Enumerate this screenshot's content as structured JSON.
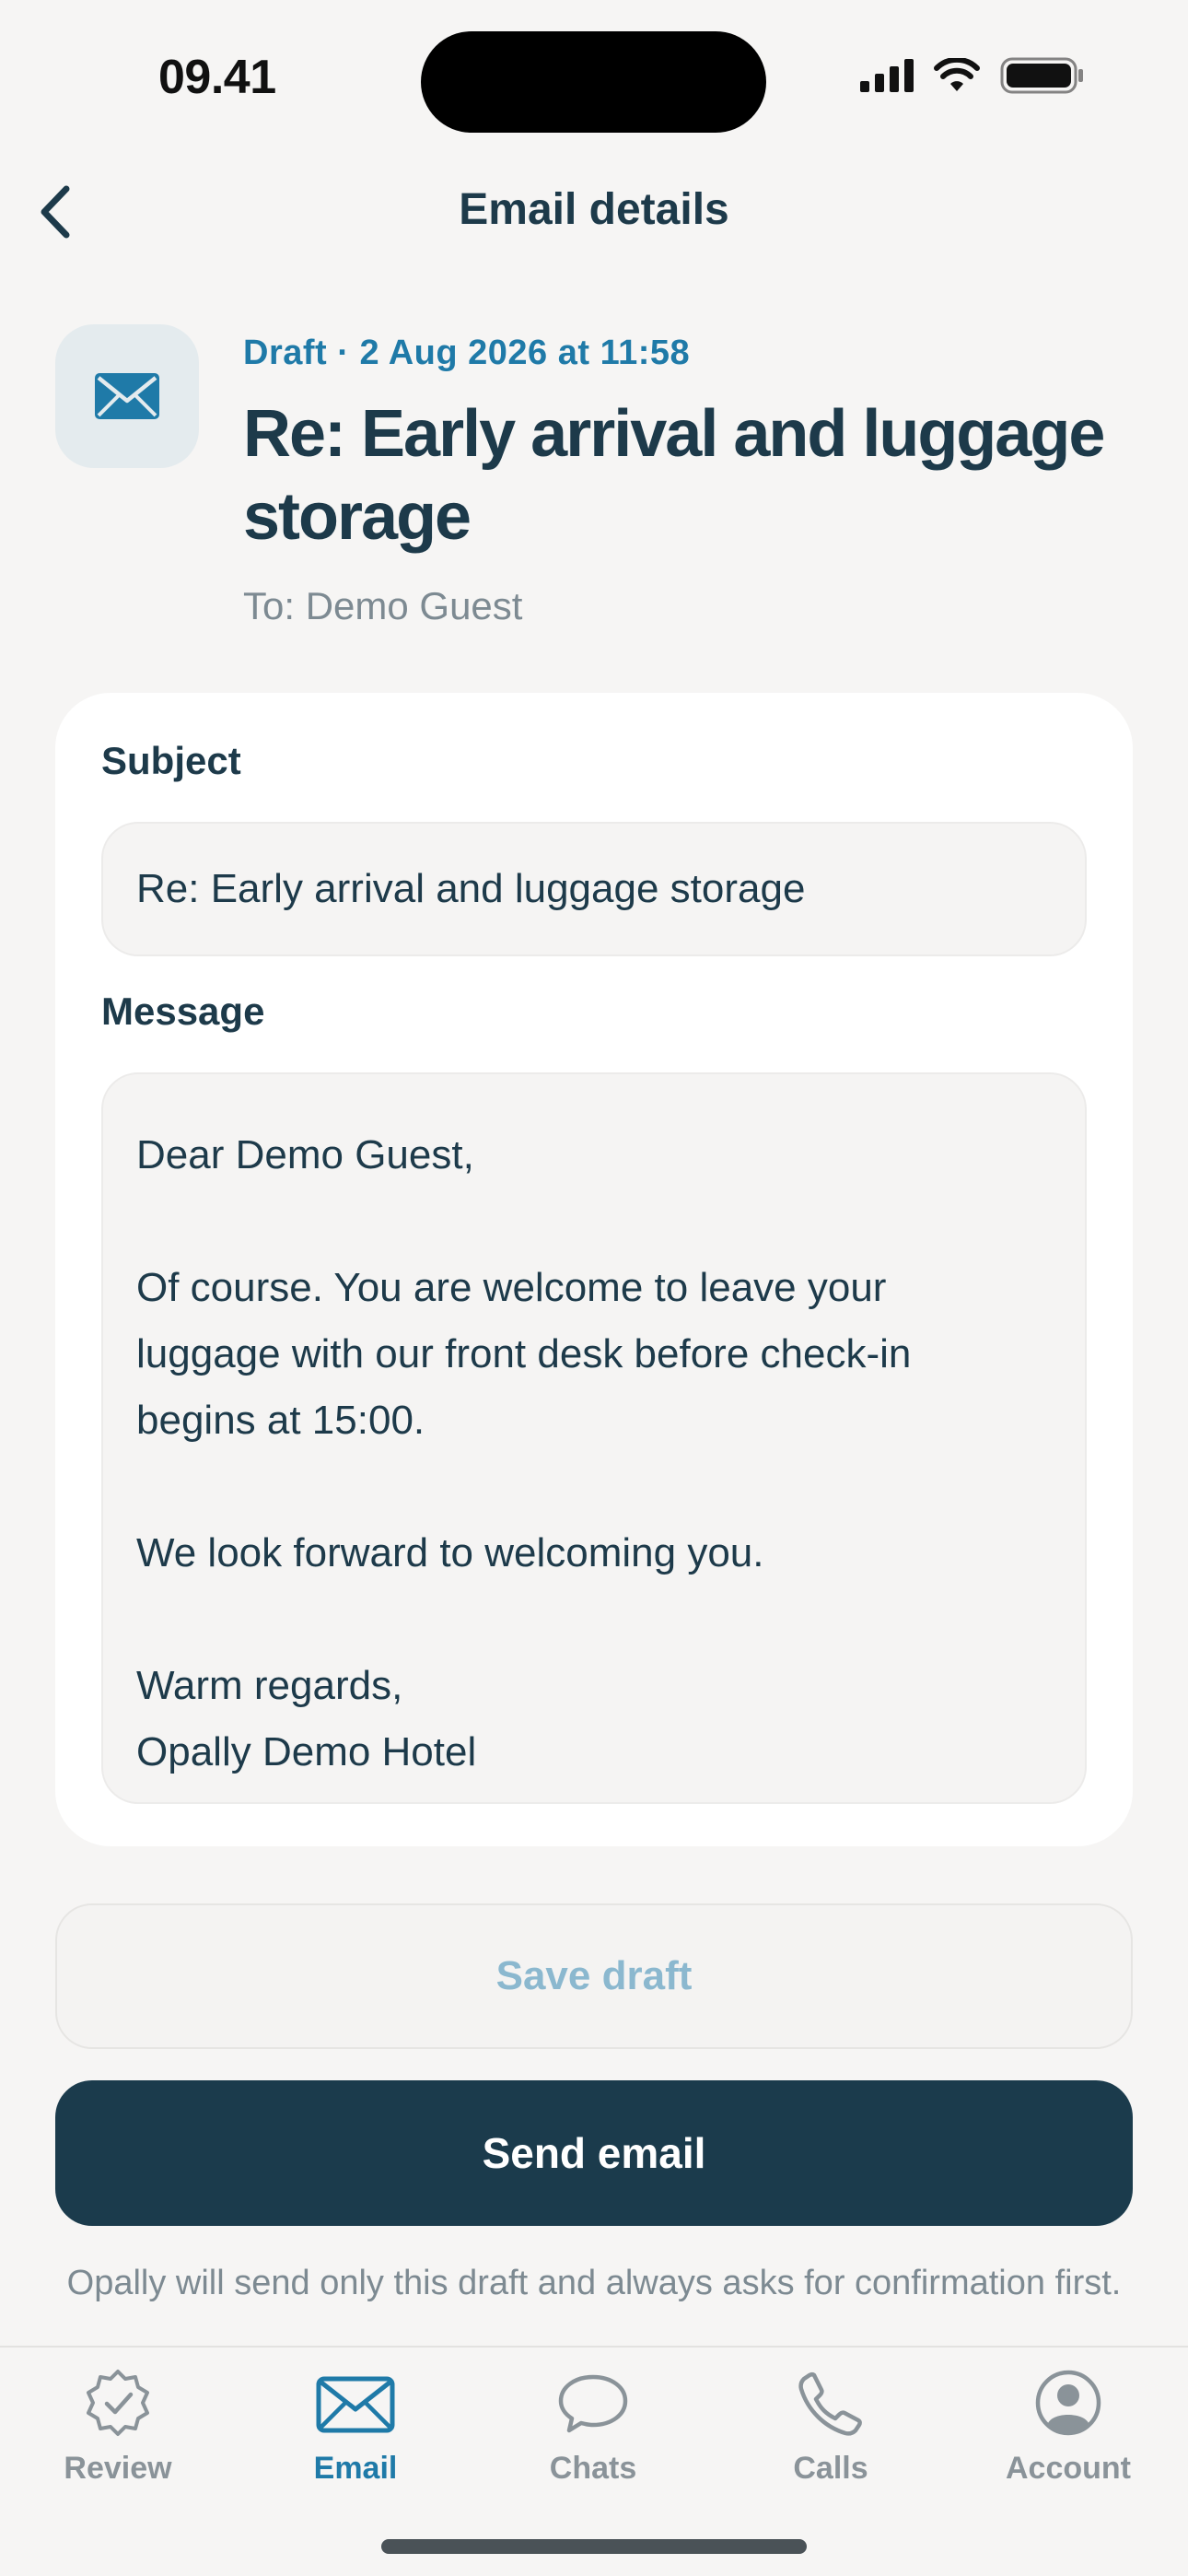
{
  "status_bar": {
    "time": "09.41"
  },
  "header": {
    "title": "Email details"
  },
  "email": {
    "meta": "Draft · 2 Aug 2026 at 11:58",
    "title": "Re: Early arrival and luggage storage",
    "to": "To: Demo Guest"
  },
  "form": {
    "subject_label": "Subject",
    "subject_value": "Re: Early arrival and luggage storage",
    "message_label": "Message",
    "message_lines": {
      "greeting": "Dear Demo Guest,",
      "body1": "Of course. You are welcome to leave your",
      "body2": "luggage with our front desk before check-in",
      "body3": "begins at 15:00.",
      "body4": "We look forward to welcoming you.",
      "closing": "Warm regards,",
      "signature": "Opally Demo Hotel"
    }
  },
  "actions": {
    "save_label": "Save draft",
    "send_label": "Send email",
    "disclaimer": "Opally will send only this draft and always asks for confirmation first."
  },
  "tabs": [
    {
      "label": "Review",
      "icon": "badge-check-icon"
    },
    {
      "label": "Email",
      "icon": "envelope-icon",
      "active": true
    },
    {
      "label": "Chats",
      "icon": "chat-bubble-icon"
    },
    {
      "label": "Calls",
      "icon": "phone-icon"
    },
    {
      "label": "Account",
      "icon": "user-circle-icon"
    }
  ],
  "colors": {
    "accent": "#1f7aa8",
    "primary_button": "#1b3b4c",
    "text": "#1d3a4a",
    "muted": "#7d8a92",
    "background": "#f6f5f4"
  }
}
